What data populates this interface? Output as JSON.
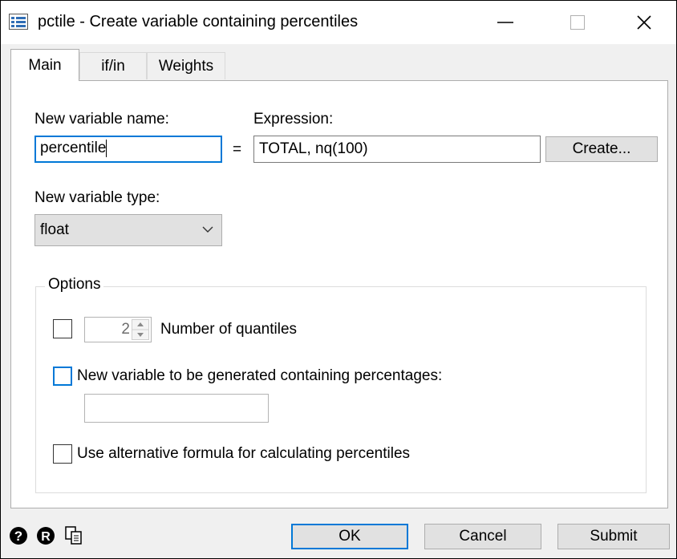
{
  "window": {
    "title": "pctile - Create variable containing percentiles"
  },
  "tabs": [
    {
      "label": "Main",
      "selected": true
    },
    {
      "label": "if/in",
      "selected": false
    },
    {
      "label": "Weights",
      "selected": false
    }
  ],
  "main": {
    "new_var_label": "New variable name:",
    "new_var_value": "percentile",
    "equals": "=",
    "expression_label": "Expression:",
    "expression_value": "TOTAL, nq(100)",
    "create_button": "Create...",
    "var_type_label": "New variable type:",
    "var_type_value": "float"
  },
  "options": {
    "legend": "Options",
    "quantiles_value": "2",
    "quantiles_label": "Number of quantiles",
    "percentages_label": "New variable to be generated containing percentages:",
    "percentages_value": "",
    "altdef_label": "Use alternative formula for calculating percentiles"
  },
  "footer": {
    "ok": "OK",
    "cancel": "Cancel",
    "submit": "Submit",
    "icons": [
      "help-icon",
      "reset-icon",
      "copy-icon"
    ]
  },
  "colors": {
    "accent": "#0078d7",
    "button_face": "#e1e1e1",
    "dialog_bg": "#f0f0f0"
  }
}
